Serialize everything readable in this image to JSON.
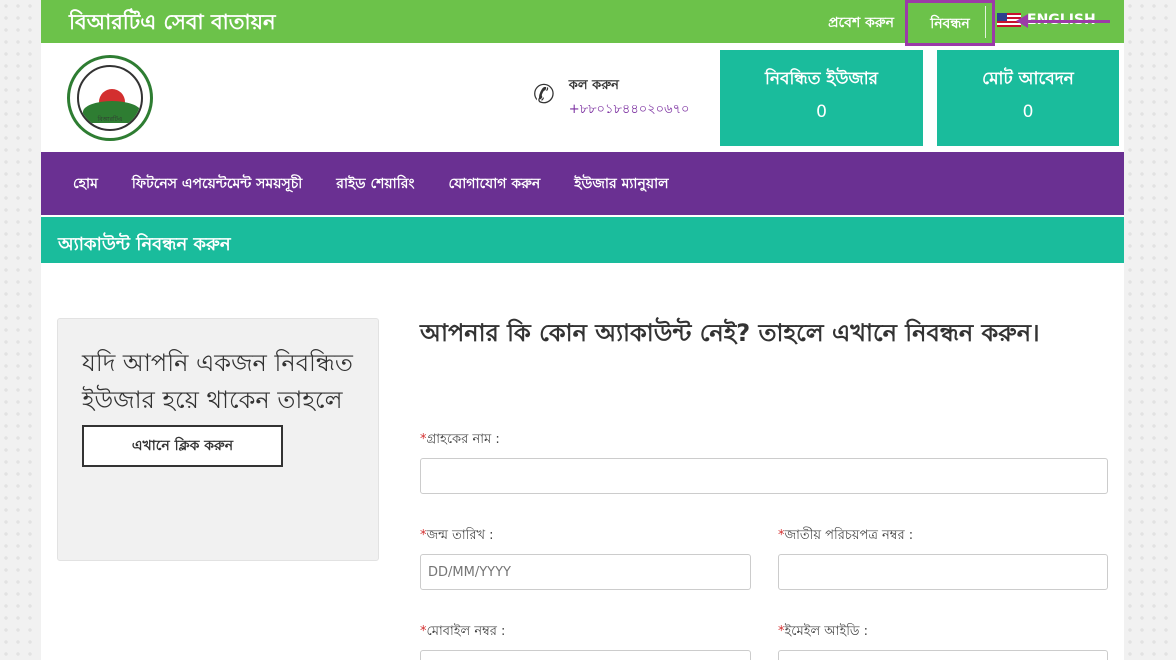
{
  "topbar": {
    "site_title": "বিআরটিএ সেবা বাতায়ন",
    "login_label": "প্রবেশ করুন",
    "register_label": "নিবন্ধন",
    "english_label": "ENGLISH"
  },
  "header": {
    "logo_text": "বিআরটিএ",
    "call_label": "কল করুন",
    "call_number": "+৮৮০১৮৪৪০২০৬৭০",
    "stats": [
      {
        "label": "নিবন্ধিত ইউজার",
        "value": "0"
      },
      {
        "label": "মোট আবেদন",
        "value": "0"
      }
    ]
  },
  "nav": {
    "items": [
      "হোম",
      "ফিটনেস এপয়েন্টমেন্ট সময়সূচী",
      "রাইড শেয়ারিং",
      "যোগাযোগ করুন",
      "ইউজার ম্যানুয়াল"
    ]
  },
  "section": {
    "title": "অ্যাকাউন্ট নিবন্ধন করুন"
  },
  "sidebar": {
    "text": "যদি আপনি একজন নিবন্ধিত ইউজার হয়ে থাকেন তাহলে",
    "button_label": "এখানে ক্লিক করুন"
  },
  "form": {
    "title": "আপনার কি কোন অ্যাকাউন্ট নেই? তাহলে এখানে নিবন্ধন করুন।",
    "required_mark": "*",
    "fields": {
      "name": {
        "label": "গ্রাহকের নাম :",
        "placeholder": ""
      },
      "dob": {
        "label": "জন্ম তারিখ :",
        "placeholder": "DD/MM/YYYY"
      },
      "nid": {
        "label": "জাতীয় পরিচয়পত্র নম্বর :",
        "placeholder": ""
      },
      "mobile": {
        "label": "মোবাইল নম্বর :",
        "placeholder": ""
      },
      "email": {
        "label": "ইমেইল আইডি :",
        "placeholder": ""
      }
    }
  },
  "colors": {
    "topbar_green": "#6cc24a",
    "teal": "#1abc9c",
    "nav_purple": "#6a3092",
    "highlight_purple": "#9b3aa8"
  }
}
